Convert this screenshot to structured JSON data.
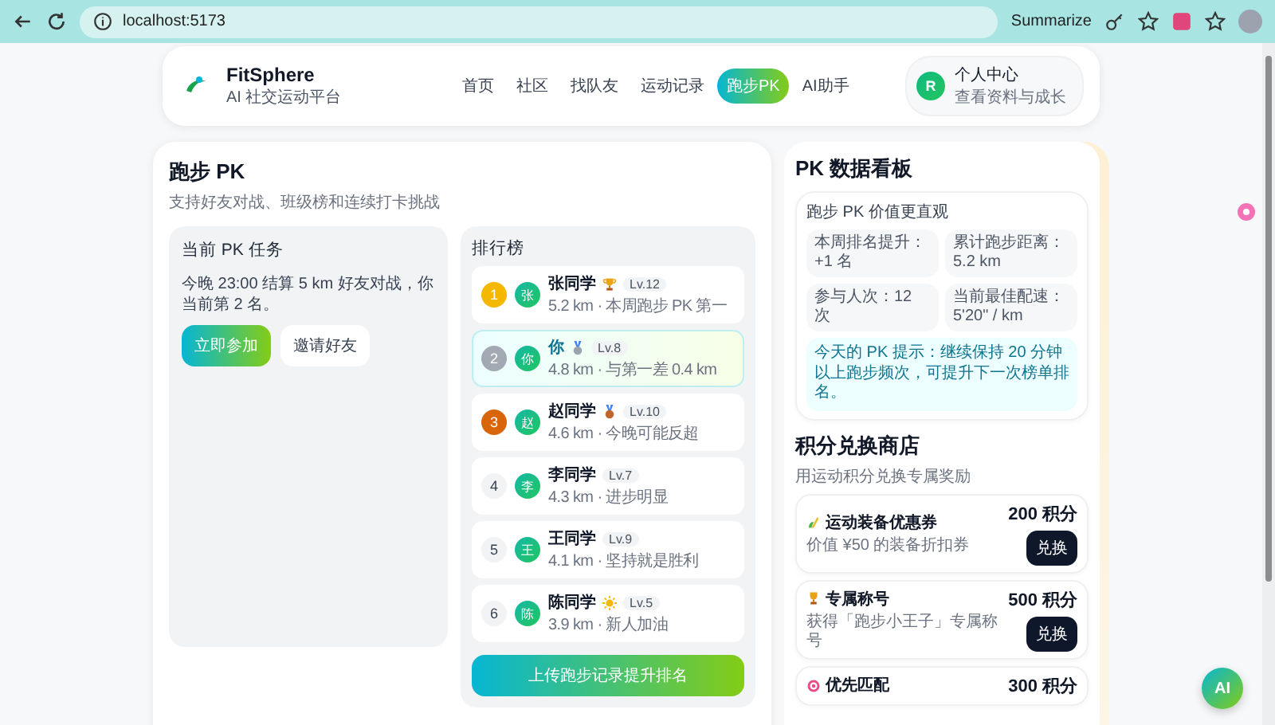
{
  "browser": {
    "url": "localhost:5173",
    "summarize": "Summarize"
  },
  "header": {
    "brand": "FitSphere",
    "tagline": "AI 社交运动平台",
    "nav": [
      {
        "label": "首页",
        "selected": false
      },
      {
        "label": "社区",
        "selected": false
      },
      {
        "label": "找队友",
        "selected": false
      },
      {
        "label": "运动记录",
        "selected": false
      },
      {
        "label": "跑步PK",
        "selected": true
      },
      {
        "label": "AI助手",
        "selected": false
      }
    ],
    "profile": {
      "avatar": "R",
      "title": "个人中心",
      "subtitle": "查看资料与成长"
    }
  },
  "pk": {
    "title": "跑步 PK",
    "subtitle": "支持好友对战、班级榜和连续打卡挑战",
    "task": {
      "title": "当前 PK 任务",
      "text": "今晚 23:00 结算 5 km 好友对战，你当前第 2 名。",
      "buttons": [
        {
          "label": "立即参加",
          "kind": "primary"
        },
        {
          "label": "邀请好友",
          "kind": "secondary"
        }
      ]
    },
    "leaderboard": {
      "title": "排行榜",
      "rows": [
        {
          "rank": "1",
          "avatar": "张",
          "name": "张同学",
          "kind": "trophy",
          "level": "Lv.12",
          "detail": "5.2 km · 本周跑步 PK 第一",
          "color": "#f5b800",
          "podium": true,
          "highlighted": false
        },
        {
          "rank": "2",
          "avatar": "你",
          "name": "你",
          "kind": "silver-medal",
          "level": "Lv.8",
          "detail": "4.8 km · 与第一差 0.4 km",
          "color": "#a3a9b2",
          "podium": true,
          "highlighted": true
        },
        {
          "rank": "3",
          "avatar": "赵",
          "name": "赵同学",
          "kind": "bronze-medal",
          "level": "Lv.10",
          "detail": "4.6 km · 今晚可能反超",
          "color": "#d9650a",
          "podium": true,
          "highlighted": false
        },
        {
          "rank": "4",
          "avatar": "李",
          "name": "李同学",
          "kind": "plain",
          "level": "Lv.7",
          "detail": "4.3 km · 进步明显",
          "color": "#f1f3f5",
          "podium": false,
          "highlighted": false
        },
        {
          "rank": "5",
          "avatar": "王",
          "name": "王同学",
          "kind": "plain",
          "level": "Lv.9",
          "detail": "4.1 km · 坚持就是胜利",
          "color": "#f1f3f5",
          "podium": false,
          "highlighted": false
        },
        {
          "rank": "6",
          "avatar": "陈",
          "name": "陈同学",
          "kind": "sun",
          "level": "Lv.5",
          "detail": "3.9 km · 新人加油",
          "color": "#f1f3f5",
          "podium": false,
          "highlighted": false
        }
      ],
      "action": "上传跑步记录提升排名"
    }
  },
  "dashboard": {
    "title": "PK 数据看板",
    "card_title": "跑步 PK 价值更直观",
    "stats": [
      "本周排名提升：+1 名",
      "累计跑步距离：5.2 km",
      "参与人次：12 次",
      "当前最佳配速：5'20\" / km"
    ],
    "tip": "今天的 PK 提示：继续保持 20 分钟以上跑步频次，可提升下一次榜单排名。"
  },
  "shop": {
    "title": "积分兑换商店",
    "subtitle": "用运动积分兑换专属奖励",
    "items": [
      {
        "kind": "coupon",
        "name": "运动装备优惠券",
        "desc": "价值 ¥50 的装备折扣券",
        "points": "200 积分",
        "button": "兑换"
      },
      {
        "kind": "title",
        "name": "专属称号",
        "desc": "获得「跑步小王子」专属称号",
        "points": "500 积分",
        "button": "兑换"
      },
      {
        "kind": "matching",
        "name": "优先匹配",
        "points": "300 积分"
      }
    ]
  },
  "assistant_button": "AI"
}
